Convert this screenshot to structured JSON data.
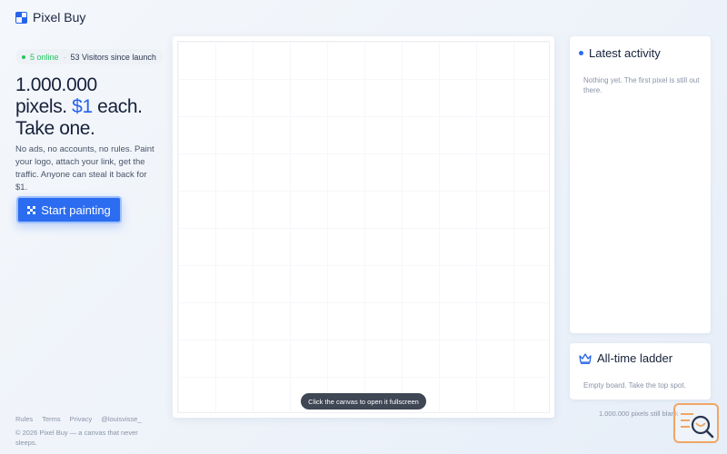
{
  "brand": {
    "name": "Pixel Buy"
  },
  "status": {
    "online": "5 online",
    "separator": "·",
    "visitors": "53 Visitors since launch"
  },
  "hero": {
    "line1": "1.000.000",
    "line2_pre": "pixels.",
    "price": "$1",
    "line2_post": "each.",
    "line3": "Take one.",
    "description": "No ads, no accounts, no rules. Paint your logo, attach your link, get the traffic. Anyone can steal it back for $1."
  },
  "cta": {
    "label": "Start painting"
  },
  "footer": {
    "links": [
      "Rules",
      "Terms",
      "Privacy",
      "@louisvisse_"
    ],
    "copyright": "© 2026 Pixel Buy — a canvas that never sleeps."
  },
  "canvas": {
    "hint": "Click the canvas to open it fullscreen"
  },
  "activity": {
    "title": "Latest activity",
    "empty": "Nothing yet. The first pixel is still out there."
  },
  "ladder": {
    "title": "All-time ladder",
    "empty": "Empty board. Take the top spot."
  },
  "pixels_left": "1.000.000 pixels still blank",
  "icons": {
    "logo": "pixel-grid-logo",
    "cta": "pixel-pattern-icon",
    "crown": "crown-icon",
    "widget": "search-chat-icon"
  },
  "colors": {
    "accent": "#2563eb",
    "online": "#22c55e",
    "widget": "#f0a566"
  }
}
